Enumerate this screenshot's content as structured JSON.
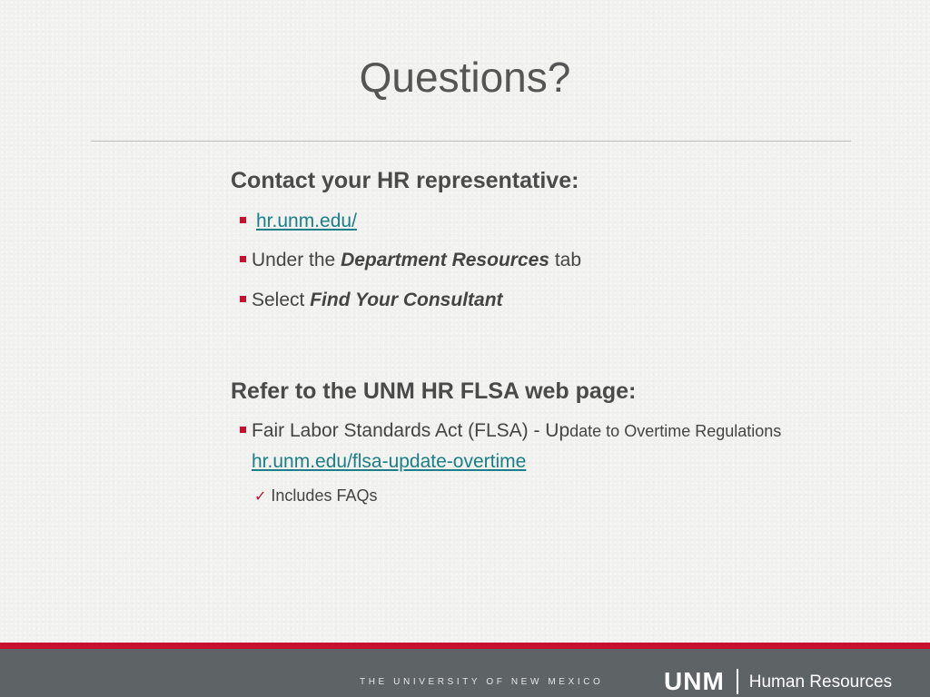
{
  "slide": {
    "title": "Questions?"
  },
  "contact": {
    "heading": "Contact your HR representative:",
    "link": "hr.unm.edu/",
    "under_prefix": "Under the ",
    "under_em": "Department Resources",
    "under_suffix": " tab",
    "select_prefix": "Select ",
    "select_em": "Find Your Consultant"
  },
  "flsa": {
    "heading": "Refer to the UNM HR FLSA web page:",
    "item_prefix": "Fair Labor Standards Act (FLSA) - Up",
    "item_small": "date to Overtime Regulations",
    "item_link": "hr.unm.edu/flsa-update-overtime",
    "sub_check": "✓",
    "sub_text": "Includes FAQs"
  },
  "footer": {
    "tagline": "THE UNIVERSITY OF NEW MEXICO",
    "logo_main": "UNM",
    "logo_dept": "Human Resources"
  },
  "colors": {
    "accent": "#c8102e",
    "link": "#1a7f86",
    "footer_bg": "#5e6366"
  }
}
